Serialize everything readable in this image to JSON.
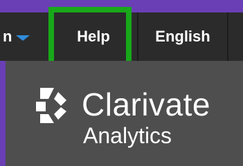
{
  "nav": {
    "partial_item": "n",
    "help_label": "Help",
    "language_label": "English"
  },
  "brand": {
    "name": "Clarivate",
    "subtitle": "Analytics"
  },
  "colors": {
    "header": "#2b2b2b",
    "page_edge": "#6a3fb5",
    "highlight": "#18a81a",
    "content_bg": "#4e4e4e",
    "caret": "#2f8cdc"
  },
  "icons": {
    "dropdown": "chevron-down-icon",
    "logo": "clarivate-logo-icon"
  }
}
